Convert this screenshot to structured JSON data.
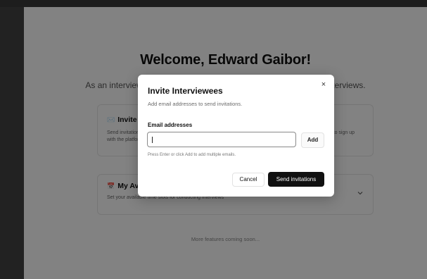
{
  "page": {
    "welcome_title": "Welcome, Edward Gaibor!",
    "subtitle": "As an interviewer, you can invite interviewees and manage your interviews.",
    "coming_soon": "More features coming soon..."
  },
  "cards": {
    "invite": {
      "icon": "envelope-emoji",
      "emoji": "✉️",
      "title": "Invite Interviewees",
      "description": "Send invitations to interviewees by entering their email addresses. They will receive an email with a link to sign up with the platform."
    },
    "availability": {
      "icon": "calendar-emoji",
      "emoji": "📅",
      "title": "My Availability",
      "description": "Set your available time slots for conducting interviews"
    }
  },
  "modal": {
    "title": "Invite Interviewees",
    "description": "Add email addresses to send invitations.",
    "close_symbol": "×",
    "email_label": "Email addresses",
    "email_value": "",
    "email_placeholder": "",
    "add_label": "Add",
    "hint": "Press Enter or click Add to add multiple emails.",
    "cancel_label": "Cancel",
    "send_label": "Send invitations"
  },
  "colors": {
    "overlay": "#000000",
    "primary_button": "#111111",
    "page_background": "#ffffff",
    "frame": "#1f1f1f"
  }
}
